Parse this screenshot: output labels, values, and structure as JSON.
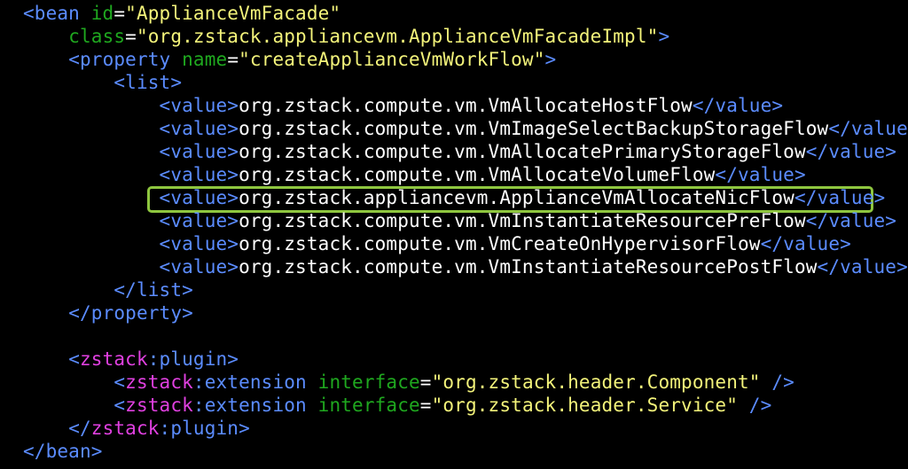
{
  "colors": {
    "background": "#000000",
    "tag": "#5b8cff",
    "attr": "#1fa81f",
    "value": "#f3f37a",
    "text": "#ffffff",
    "namespace": "#e040e0",
    "highlight": "#8ec63f"
  },
  "code": [
    [
      {
        "t": "<bean ",
        "c": "tag"
      },
      {
        "t": "id",
        "c": "attr"
      },
      {
        "t": "=",
        "c": "text"
      },
      {
        "t": "\"ApplianceVmFacade\"",
        "c": "value"
      }
    ],
    [
      {
        "t": "    ",
        "c": "text"
      },
      {
        "t": "class",
        "c": "attr"
      },
      {
        "t": "=",
        "c": "text"
      },
      {
        "t": "\"org.zstack.appliancevm.ApplianceVmFacadeImpl\"",
        "c": "value"
      },
      {
        "t": ">",
        "c": "tag"
      }
    ],
    [
      {
        "t": "    ",
        "c": "text"
      },
      {
        "t": "<property ",
        "c": "tag"
      },
      {
        "t": "name",
        "c": "attr"
      },
      {
        "t": "=",
        "c": "text"
      },
      {
        "t": "\"createApplianceVmWorkFlow\"",
        "c": "value"
      },
      {
        "t": ">",
        "c": "tag"
      }
    ],
    [
      {
        "t": "        ",
        "c": "text"
      },
      {
        "t": "<list>",
        "c": "tag"
      }
    ],
    [
      {
        "t": "            ",
        "c": "text"
      },
      {
        "t": "<value>",
        "c": "tag"
      },
      {
        "t": "org.zstack.compute.vm.VmAllocateHostFlow",
        "c": "text"
      },
      {
        "t": "</value>",
        "c": "tag"
      }
    ],
    [
      {
        "t": "            ",
        "c": "text"
      },
      {
        "t": "<value>",
        "c": "tag"
      },
      {
        "t": "org.zstack.compute.vm.VmImageSelectBackupStorageFlow",
        "c": "text"
      },
      {
        "t": "</value>",
        "c": "tag"
      }
    ],
    [
      {
        "t": "            ",
        "c": "text"
      },
      {
        "t": "<value>",
        "c": "tag"
      },
      {
        "t": "org.zstack.compute.vm.VmAllocatePrimaryStorageFlow",
        "c": "text"
      },
      {
        "t": "</value>",
        "c": "tag"
      }
    ],
    [
      {
        "t": "            ",
        "c": "text"
      },
      {
        "t": "<value>",
        "c": "tag"
      },
      {
        "t": "org.zstack.compute.vm.VmAllocateVolumeFlow",
        "c": "text"
      },
      {
        "t": "</value>",
        "c": "tag"
      }
    ],
    [
      {
        "t": "            ",
        "c": "text"
      },
      {
        "t": "<value>",
        "c": "tag"
      },
      {
        "t": "org.zstack.appliancevm.ApplianceVmAllocateNicFlow",
        "c": "text"
      },
      {
        "t": "</value>",
        "c": "tag"
      }
    ],
    [
      {
        "t": "            ",
        "c": "text"
      },
      {
        "t": "<value>",
        "c": "tag"
      },
      {
        "t": "org.zstack.compute.vm.VmInstantiateResourcePreFlow",
        "c": "text"
      },
      {
        "t": "</value>",
        "c": "tag"
      }
    ],
    [
      {
        "t": "            ",
        "c": "text"
      },
      {
        "t": "<value>",
        "c": "tag"
      },
      {
        "t": "org.zstack.compute.vm.VmCreateOnHypervisorFlow",
        "c": "text"
      },
      {
        "t": "</value>",
        "c": "tag"
      }
    ],
    [
      {
        "t": "            ",
        "c": "text"
      },
      {
        "t": "<value>",
        "c": "tag"
      },
      {
        "t": "org.zstack.compute.vm.VmInstantiateResourcePostFlow",
        "c": "text"
      },
      {
        "t": "</value>",
        "c": "tag"
      }
    ],
    [
      {
        "t": "        ",
        "c": "text"
      },
      {
        "t": "</list>",
        "c": "tag"
      }
    ],
    [
      {
        "t": "    ",
        "c": "text"
      },
      {
        "t": "</property>",
        "c": "tag"
      }
    ],
    [
      {
        "t": "",
        "c": "text"
      }
    ],
    [
      {
        "t": "    ",
        "c": "text"
      },
      {
        "t": "<",
        "c": "tag"
      },
      {
        "t": "zstack",
        "c": "namespace"
      },
      {
        "t": ":plugin>",
        "c": "tag"
      }
    ],
    [
      {
        "t": "        ",
        "c": "text"
      },
      {
        "t": "<",
        "c": "tag"
      },
      {
        "t": "zstack",
        "c": "namespace"
      },
      {
        "t": ":extension ",
        "c": "tag"
      },
      {
        "t": "interface",
        "c": "attr"
      },
      {
        "t": "=",
        "c": "text"
      },
      {
        "t": "\"org.zstack.header.Component\"",
        "c": "value"
      },
      {
        "t": " />",
        "c": "tag"
      }
    ],
    [
      {
        "t": "        ",
        "c": "text"
      },
      {
        "t": "<",
        "c": "tag"
      },
      {
        "t": "zstack",
        "c": "namespace"
      },
      {
        "t": ":extension ",
        "c": "tag"
      },
      {
        "t": "interface",
        "c": "attr"
      },
      {
        "t": "=",
        "c": "text"
      },
      {
        "t": "\"org.zstack.header.Service\"",
        "c": "value"
      },
      {
        "t": " />",
        "c": "tag"
      }
    ],
    [
      {
        "t": "    ",
        "c": "text"
      },
      {
        "t": "</",
        "c": "tag"
      },
      {
        "t": "zstack",
        "c": "namespace"
      },
      {
        "t": ":plugin>",
        "c": "tag"
      }
    ],
    [
      {
        "t": "</bean>",
        "c": "tag"
      }
    ]
  ],
  "highlighted_line": 8
}
